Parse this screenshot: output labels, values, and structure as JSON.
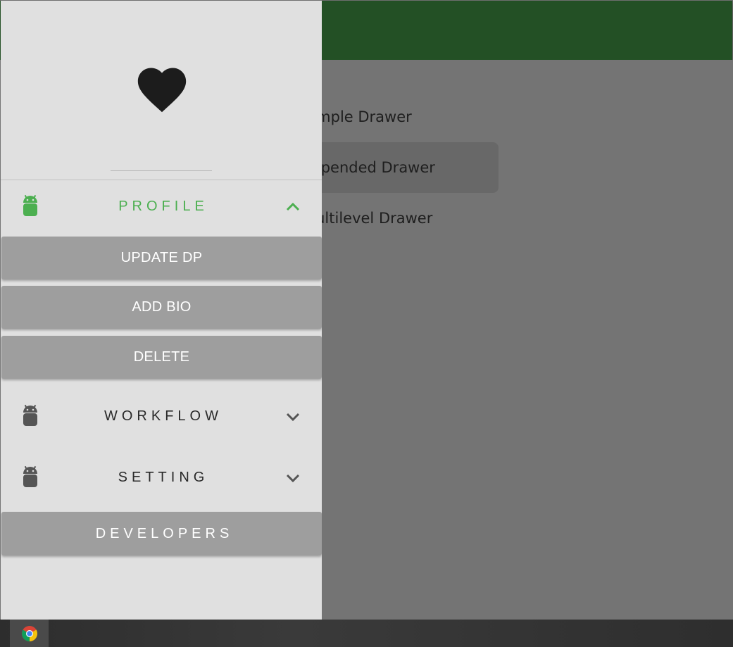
{
  "app_bar": {
    "color": "#235025"
  },
  "background_menu": {
    "items": [
      {
        "label": "Simple Drawer"
      },
      {
        "label": "Expended Drawer"
      },
      {
        "label": "Multilevel Drawer"
      }
    ],
    "selected_index": 1
  },
  "drawer": {
    "header_icon": "heart-icon",
    "sections": [
      {
        "label": "PROFILE",
        "icon": "android-icon",
        "expanded": true,
        "chevron": "chevron-up-icon",
        "sub_items": [
          "UPDATE DP",
          "ADD BIO",
          "DELETE"
        ]
      },
      {
        "label": "WORKFLOW",
        "icon": "android-icon",
        "expanded": false,
        "chevron": "chevron-down-icon"
      },
      {
        "label": "SETTING",
        "icon": "android-icon",
        "expanded": false,
        "chevron": "chevron-down-icon"
      }
    ],
    "developers_label": "DEVELOPERS",
    "colors": {
      "active": "#4caf50",
      "inactive": "#555555",
      "button_bg": "#9e9e9e"
    }
  },
  "taskbar": {
    "apps": [
      {
        "icon": "chrome-icon"
      }
    ]
  }
}
